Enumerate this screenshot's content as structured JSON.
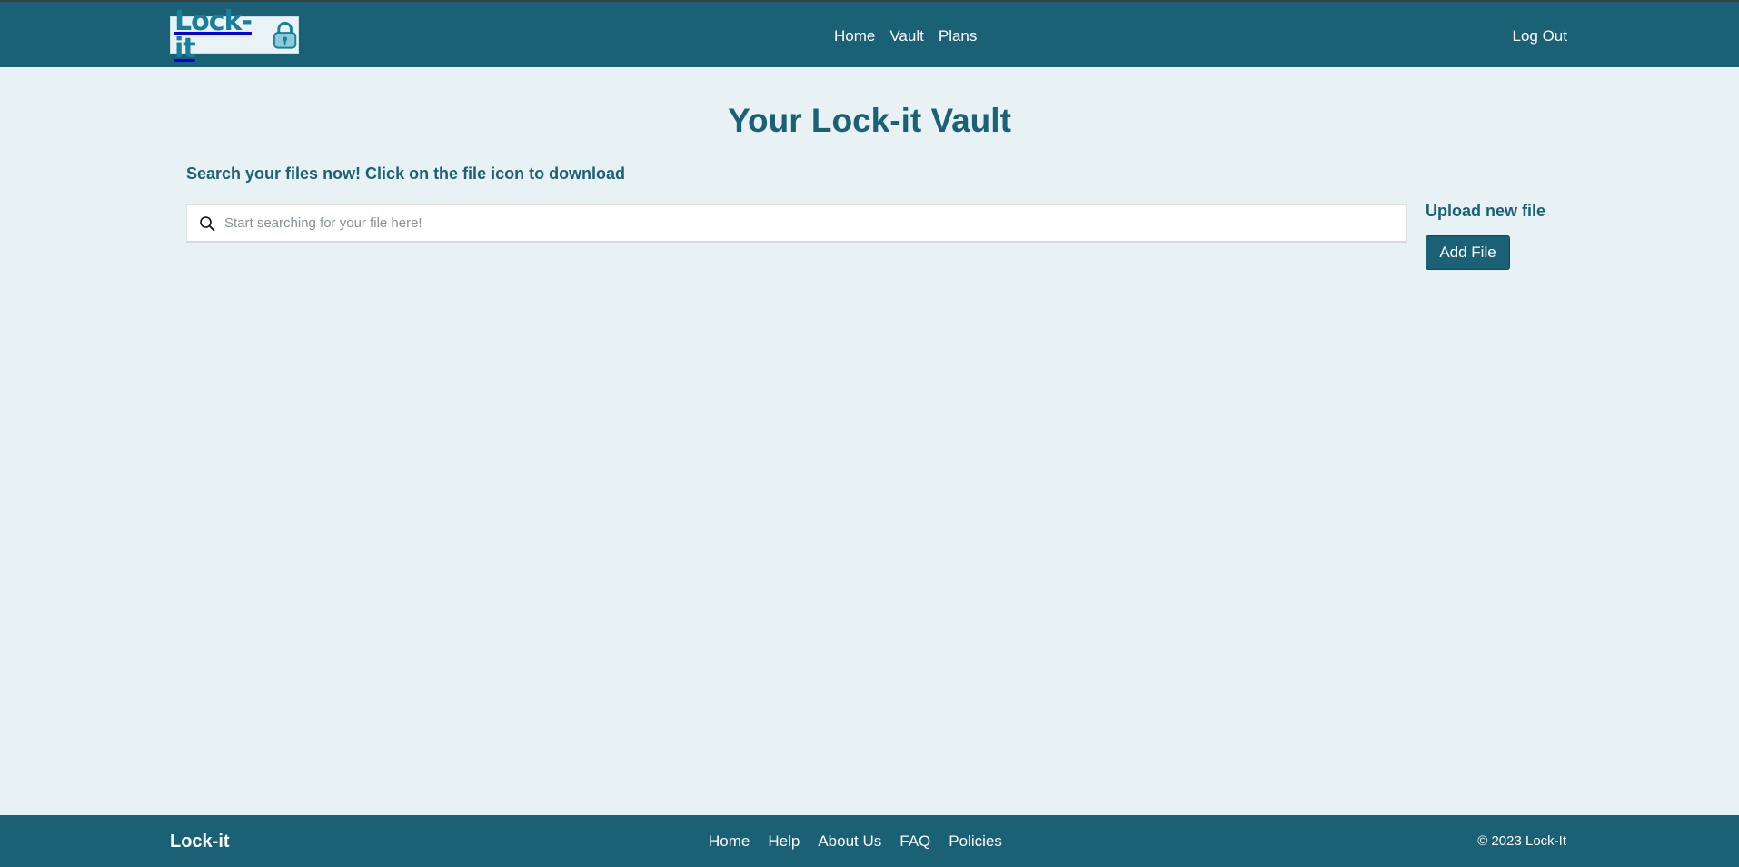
{
  "header": {
    "logo_text": "Lock-it",
    "nav": [
      "Home",
      "Vault",
      "Plans"
    ],
    "logout_label": "Log Out"
  },
  "main": {
    "title": "Your Lock-it Vault",
    "subtitle": "Search your files now! Click on the file icon to download",
    "search": {
      "placeholder": "Start searching for your file here!",
      "value": "",
      "icon": "search-icon"
    },
    "upload": {
      "title": "Upload new file",
      "button_label": "Add File"
    }
  },
  "footer": {
    "brand": "Lock-it",
    "links": [
      "Home",
      "Help",
      "About Us",
      "FAQ",
      "Policies"
    ],
    "copyright": "© 2023 Lock-It"
  },
  "colors": {
    "primary": "#1b6175",
    "background": "#e8f1f3",
    "logo_accent": "#1a7f99"
  }
}
